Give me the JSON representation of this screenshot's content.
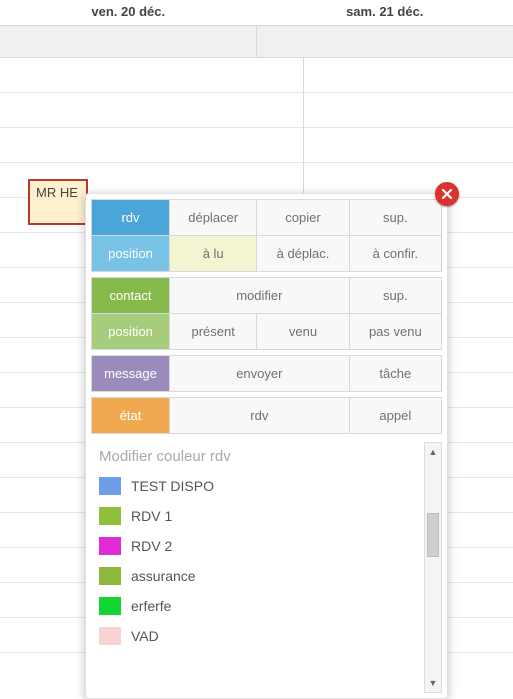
{
  "calendar": {
    "days": [
      "ven. 20 déc.",
      "sam. 21 déc."
    ],
    "event": {
      "title": "MR HE"
    }
  },
  "popup": {
    "rows": {
      "rdv": {
        "label": "rdv",
        "actions": [
          "déplacer",
          "copier",
          "sup."
        ]
      },
      "position1": {
        "label": "position",
        "actions": [
          "à lu",
          "à déplac.",
          "à confir."
        ]
      },
      "contact": {
        "label": "contact",
        "actions": [
          "modifier",
          "sup."
        ]
      },
      "position2": {
        "label": "position",
        "actions": [
          "présent",
          "venu",
          "pas venu"
        ]
      },
      "message": {
        "label": "message",
        "actions": [
          "envoyer",
          "tâche"
        ]
      },
      "etat": {
        "label": "état",
        "actions": [
          "rdv",
          "appel"
        ]
      }
    },
    "color_section_title": "Modifier couleur rdv",
    "colors": [
      {
        "label": "TEST DISPO",
        "hex": "#6f9ee8"
      },
      {
        "label": "RDV 1",
        "hex": "#8fbf3b"
      },
      {
        "label": "RDV 2",
        "hex": "#e02bd6"
      },
      {
        "label": "assurance",
        "hex": "#8db83a"
      },
      {
        "label": "erferfe",
        "hex": "#12d62f"
      },
      {
        "label": "VAD",
        "hex": "#f6d2d2"
      }
    ]
  }
}
